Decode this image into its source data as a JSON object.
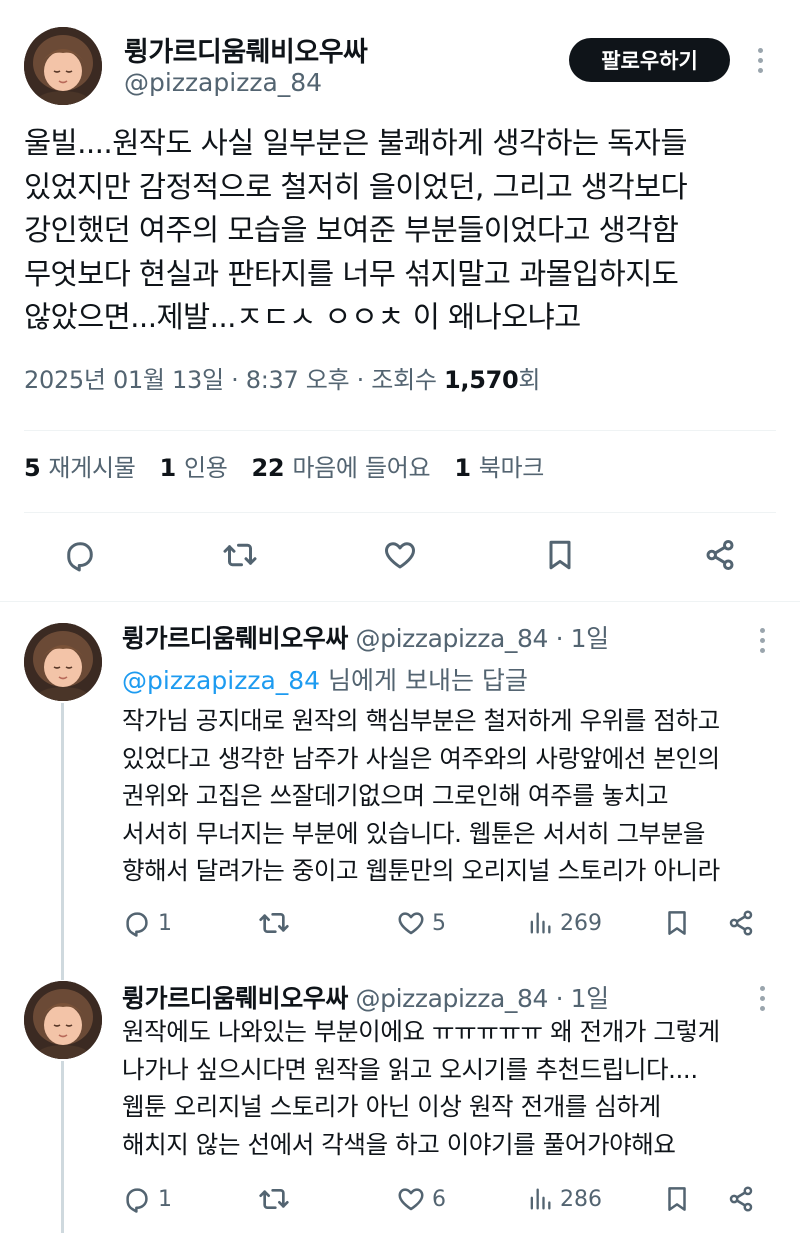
{
  "main_tweet": {
    "author_name": "륑가르디움뤠비오우싸",
    "handle": "@pizzapizza_84",
    "follow_label": "팔로우하기",
    "text_lines": [
      "울빌....원작도 사실 일부분은 불쾌하게 생각하는 독자들",
      "있었지만 감정적으로 철저히 을이었던, 그리고 생각보다",
      "강인했던 여주의 모습을 보여준 부분들이었다고 생각함",
      "무엇보다 현실과 판타지를 너무 섞지말고 과몰입하지도",
      "않았으면...제발...ㅈㄷㅅ ㅇㅇㅊ 이 왜나오냐고"
    ],
    "timestamp": "2025년 01월 13일 · 8:37 오후 · 조회수 ",
    "views": "1,570",
    "views_suffix": "회",
    "stats": {
      "reposts_count": "5",
      "reposts_label": "재게시물",
      "quotes_count": "1",
      "quotes_label": "인용",
      "likes_count": "22",
      "likes_label": "마음에 들어요",
      "bookmarks_count": "1",
      "bookmarks_label": "북마크"
    },
    "action_icons": [
      "reply-icon",
      "retweet-icon",
      "like-icon",
      "bookmark-icon",
      "share-icon"
    ]
  },
  "replies": [
    {
      "author_name": "륑가르디움뤠비오우싸",
      "handle_time": " @pizzapizza_84 · 1일",
      "replying_to_mention": "@pizzapizza_84",
      "replying_to_suffix": " 님에게 보내는 답글",
      "text_lines": [
        "작가님 공지대로 원작의 핵심부분은 철저하게 우위를 점하고",
        "있었다고 생각한 남주가 사실은 여주와의 사랑앞에선 본인의",
        "권위와 고집은 쓰잘데기없으며 그로인해 여주를 놓치고",
        "서서히 무너지는 부분에 있습니다. 웹툰은 서서히 그부분을",
        "향해서 달려가는 중이고 웹툰만의 오리지널 스토리가 아니라"
      ],
      "replies_count": "1",
      "likes_count": "5",
      "views_count": "269"
    },
    {
      "author_name": "륑가르디움뤠비오우싸",
      "handle_time": " @pizzapizza_84 · 1일",
      "text_lines": [
        "원작에도 나와있는 부분이에요 ㅠㅠㅠㅠㅠ 왜 전개가 그렇게",
        "나가나 싶으시다면 원작을 읽고 오시기를 추천드립니다....",
        "웹툰 오리지널 스토리가 아닌 이상 원작 전개를 심하게",
        "해치지 않는 선에서 각색을 하고 이야기를 풀어가야해요"
      ],
      "replies_count": "1",
      "likes_count": "6",
      "views_count": "286"
    }
  ],
  "colors": {
    "text": "#0f1419",
    "secondary": "#536471",
    "link": "#1d9bf0",
    "divider": "#eff3f4"
  }
}
